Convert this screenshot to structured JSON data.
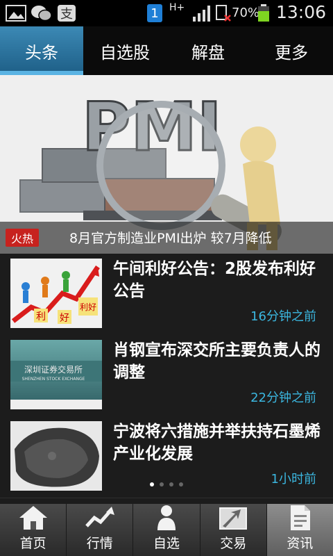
{
  "status_bar": {
    "signal_type": "H+",
    "battery": "70%",
    "time": "13:06",
    "notification_count": "1"
  },
  "tabs": [
    {
      "label": "头条",
      "active": true
    },
    {
      "label": "自选股",
      "active": false
    },
    {
      "label": "解盘",
      "active": false
    },
    {
      "label": "更多",
      "active": false
    }
  ],
  "hero": {
    "image_text": "PMI",
    "badge": "火热",
    "title": "8月官方制造业PMI出炉 较7月降低"
  },
  "news": [
    {
      "title": "午间利好公告：2股发布利好公告",
      "time": "16分钟之前",
      "thumb_words": [
        "利",
        "好",
        "利好"
      ]
    },
    {
      "title": "肖钢宣布深交所主要负责人的调整",
      "time": "22分钟之前",
      "thumb_words": [
        "深圳证券交易所",
        "SHENZHEN STOCK EXCHANGE"
      ]
    },
    {
      "title": "宁波将六措施并举扶持石墨烯产业化发展",
      "time": "1小时前",
      "thumb_words": []
    }
  ],
  "carousel": {
    "pages": 4,
    "current": 1
  },
  "bottom_nav": [
    {
      "label": "首页",
      "icon": "home-icon",
      "active": false
    },
    {
      "label": "行情",
      "icon": "trend-icon",
      "active": false
    },
    {
      "label": "自选",
      "icon": "person-icon",
      "active": false
    },
    {
      "label": "交易",
      "icon": "exchange-icon",
      "active": false
    },
    {
      "label": "资讯",
      "icon": "document-icon",
      "active": true
    }
  ],
  "colors": {
    "accent": "#3c89b5",
    "time_text": "#3bb7e0",
    "hot_badge": "#c7221e"
  }
}
